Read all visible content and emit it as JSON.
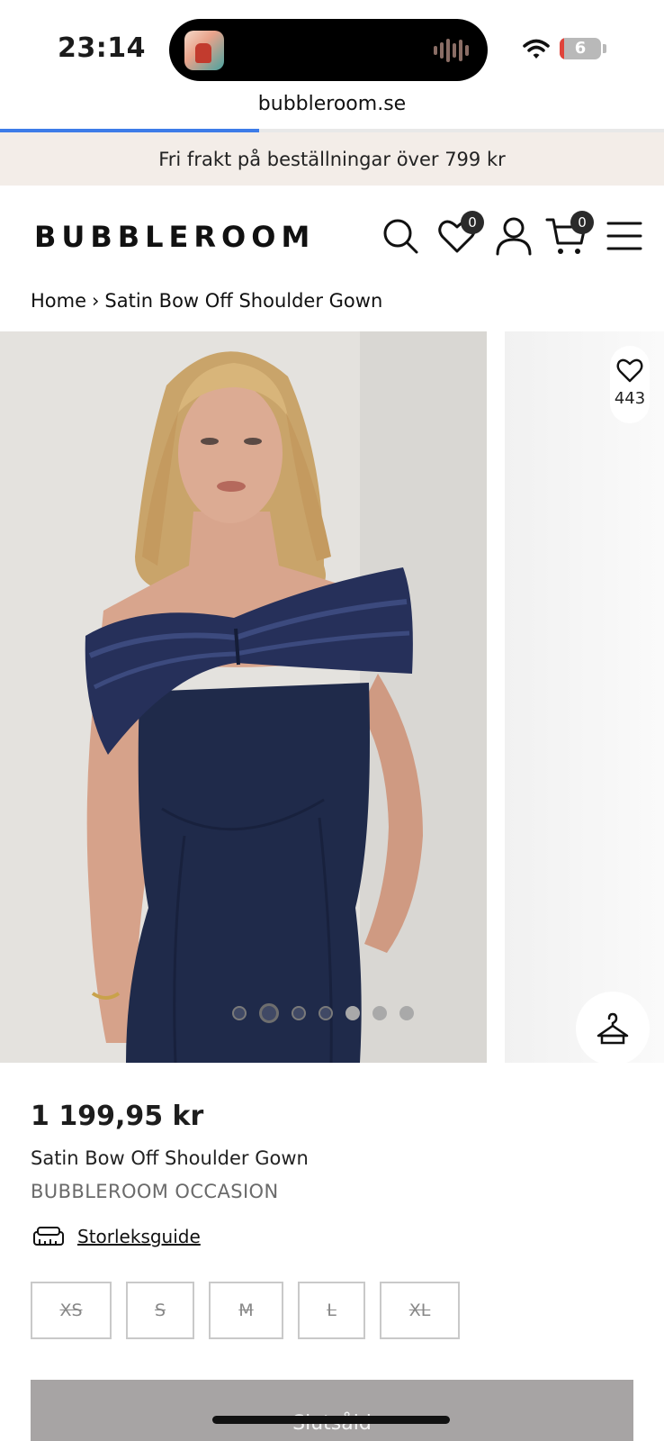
{
  "status_bar": {
    "time": "23:14",
    "battery": "6",
    "battery_color": "#e0443b"
  },
  "browser": {
    "url": "bubbleroom.se",
    "load_progress": 0.39
  },
  "promo": {
    "text": "Fri frakt på beställningar över 799 kr"
  },
  "header": {
    "logo": "BUBBLEROOM",
    "wishlist_count": "0",
    "cart_count": "0",
    "icons": [
      "search-icon",
      "heart-icon",
      "user-icon",
      "cart-icon",
      "menu-icon"
    ]
  },
  "breadcrumb": {
    "home": "Home",
    "separator": "›",
    "current": "Satin Bow Off Shoulder Gown"
  },
  "gallery": {
    "image_count": 7,
    "active_index": 1,
    "wishlist_count": "443",
    "dress_color": "#1f2a4a"
  },
  "product": {
    "price": "1 199,95 kr",
    "name": "Satin Bow Off Shoulder Gown",
    "brand": "BUBBLEROOM OCCASION",
    "size_guide": "Storleksguide",
    "sizes": [
      "XS",
      "S",
      "M",
      "L",
      "XL"
    ],
    "buy_label": "Slutsåld"
  }
}
